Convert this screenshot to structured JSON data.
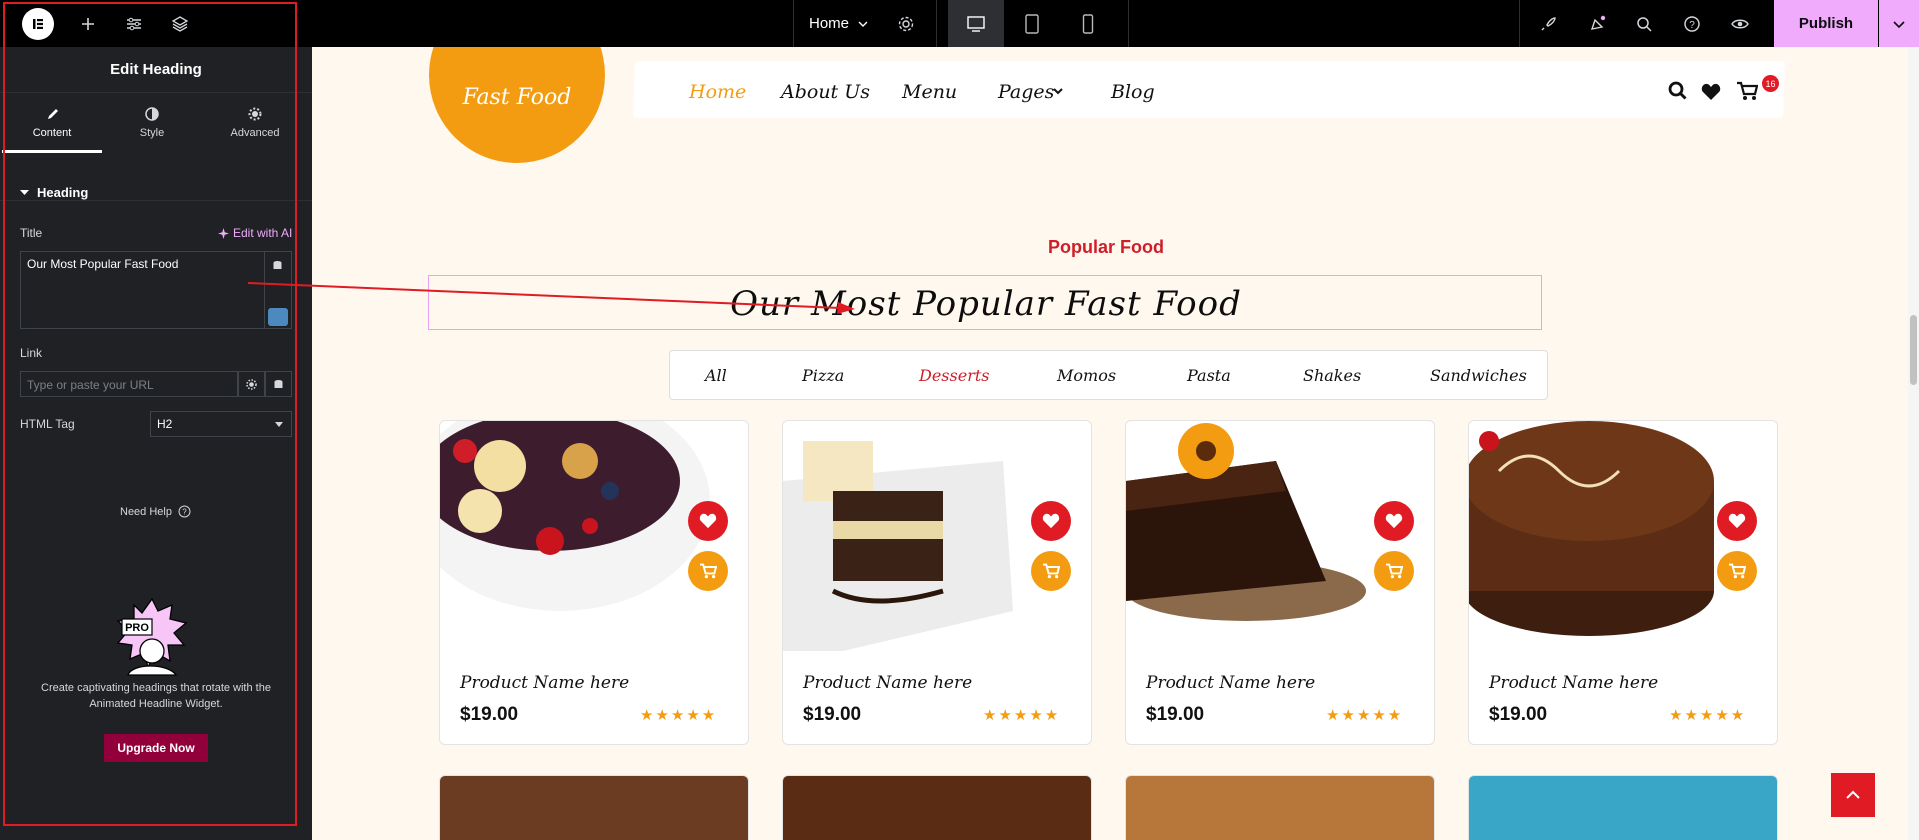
{
  "topbar": {
    "page_name": "Home",
    "publish_label": "Publish"
  },
  "panel": {
    "title": "Edit Heading",
    "tabs": [
      {
        "label": "Content",
        "icon": "pencil-icon"
      },
      {
        "label": "Style",
        "icon": "contrast-icon"
      },
      {
        "label": "Advanced",
        "icon": "gear-icon"
      }
    ],
    "section": "Heading",
    "title_label": "Title",
    "edit_ai": "Edit with AI",
    "title_value": "Our Most Popular Fast Food",
    "link_label": "Link",
    "link_placeholder": "Type or paste your URL",
    "html_tag_label": "HTML Tag",
    "html_tag_value": "H2",
    "need_help": "Need Help",
    "promo_text": "Create captivating headings that rotate with the Animated Headline Widget.",
    "upgrade_label": "Upgrade Now"
  },
  "site": {
    "logo": "Fast Food",
    "nav": [
      "Home",
      "About Us",
      "Menu",
      "Pages",
      "Blog"
    ],
    "cart_count": "16",
    "subtitle": "Popular Food",
    "heading": "Our Most Popular Fast Food",
    "filters": [
      "All",
      "Pizza",
      "Desserts",
      "Momos",
      "Pasta",
      "Shakes",
      "Sandwiches"
    ],
    "active_filter": "Desserts",
    "products": [
      {
        "name": "Product Name here",
        "price": "$19.00",
        "rating": 5
      },
      {
        "name": "Product Name here",
        "price": "$19.00",
        "rating": 5
      },
      {
        "name": "Product Name here",
        "price": "$19.00",
        "rating": 5
      },
      {
        "name": "Product Name here",
        "price": "$19.00",
        "rating": 5
      }
    ]
  },
  "colors": {
    "accent": "#f39c12",
    "red": "#d01e29",
    "pink": "#f0abfc",
    "panel_bg": "#1f2124"
  }
}
